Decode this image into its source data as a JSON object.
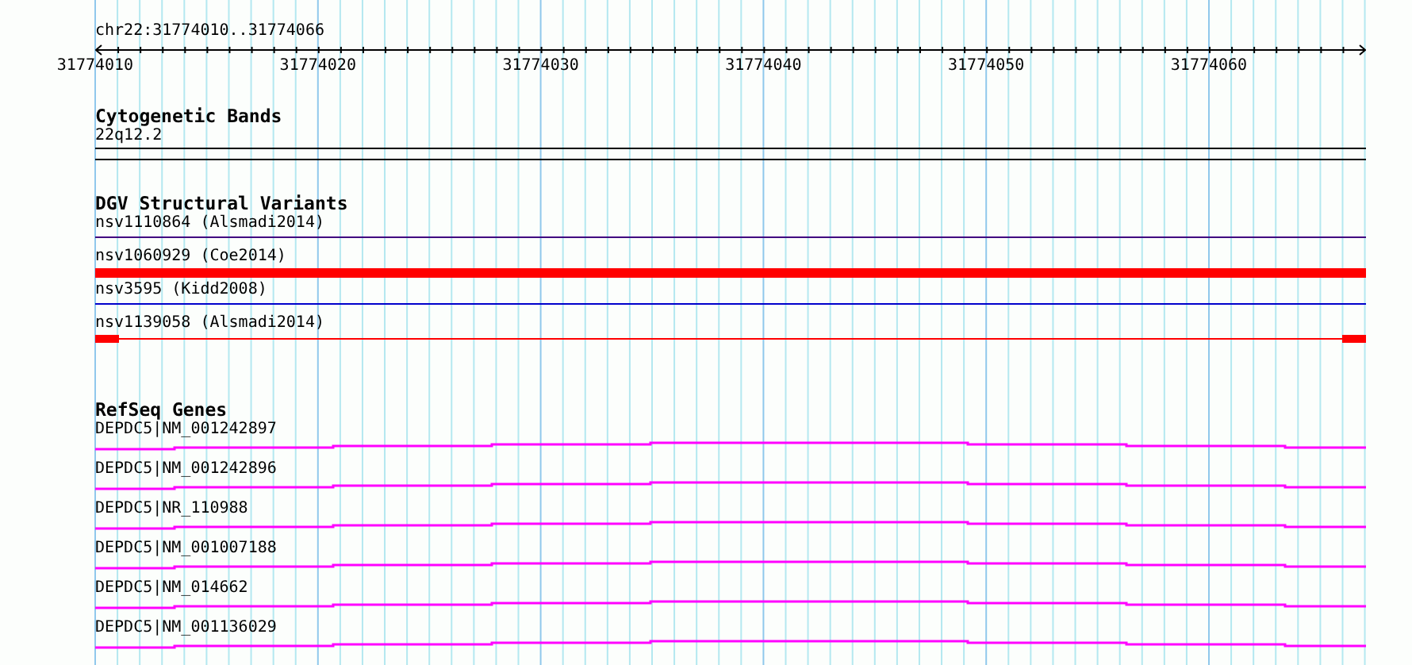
{
  "ruler": {
    "position": "chr22:31774010..31774066",
    "ticks": [
      "31774010",
      "31774020",
      "31774030",
      "31774040",
      "31774050",
      "31774060"
    ]
  },
  "tracks": [
    {
      "kind": "bands",
      "title": "Cytogenetic Bands",
      "features": [
        {
          "label": "22q12.2"
        }
      ]
    },
    {
      "kind": "variants",
      "title": "DGV Structural Variants",
      "features": [
        {
          "label": "nsv1110864 (Alsmadi2014)",
          "kind": "line",
          "color": "#400080"
        },
        {
          "label": "nsv1060929 (Coe2014)",
          "kind": "bar",
          "color": "#ff0000"
        },
        {
          "label": "nsv3595 (Kidd2008)",
          "kind": "line",
          "color": "#0000cc"
        },
        {
          "label": "nsv1139058 (Alsmadi2014)",
          "kind": "ends",
          "color": "#ff0000"
        }
      ]
    },
    {
      "kind": "genes",
      "title": "RefSeq Genes",
      "features": [
        {
          "label": "DEPDC5|NM_001242897"
        },
        {
          "label": "DEPDC5|NM_001242896"
        },
        {
          "label": "DEPDC5|NR_110988"
        },
        {
          "label": "DEPDC5|NM_001007188"
        },
        {
          "label": "DEPDC5|NM_014662"
        },
        {
          "label": "DEPDC5|NM_001136029"
        }
      ]
    }
  ]
}
